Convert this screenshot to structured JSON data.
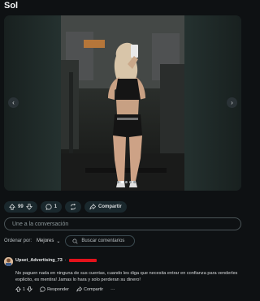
{
  "post": {
    "title": "Sol"
  },
  "media": {
    "slide_count": 5,
    "active_slide": 1
  },
  "actions": {
    "vote_count": "99",
    "comment_count": "1",
    "share_label": "Compartir"
  },
  "comment_box": {
    "placeholder": "Une a la conversación"
  },
  "sort": {
    "label": "Ordenar por:",
    "value": "Mejores",
    "search_placeholder": "Buscar comentarios"
  },
  "comment": {
    "author": "Upset_Advertising_73",
    "separator": "·",
    "text": "No paguen nada en ninguna de sus cuentas, cuando les diga que necesita entrar en confianza para venderles explicito, es mentira! Jamas lo hara y solo perderan su dinero!",
    "votes": "1",
    "reply_label": "Responder",
    "share_label": "Compartir",
    "more": "···"
  },
  "colors": {
    "background": "#0e1113",
    "pill": "#1a282d",
    "redaction": "#e3121b"
  }
}
